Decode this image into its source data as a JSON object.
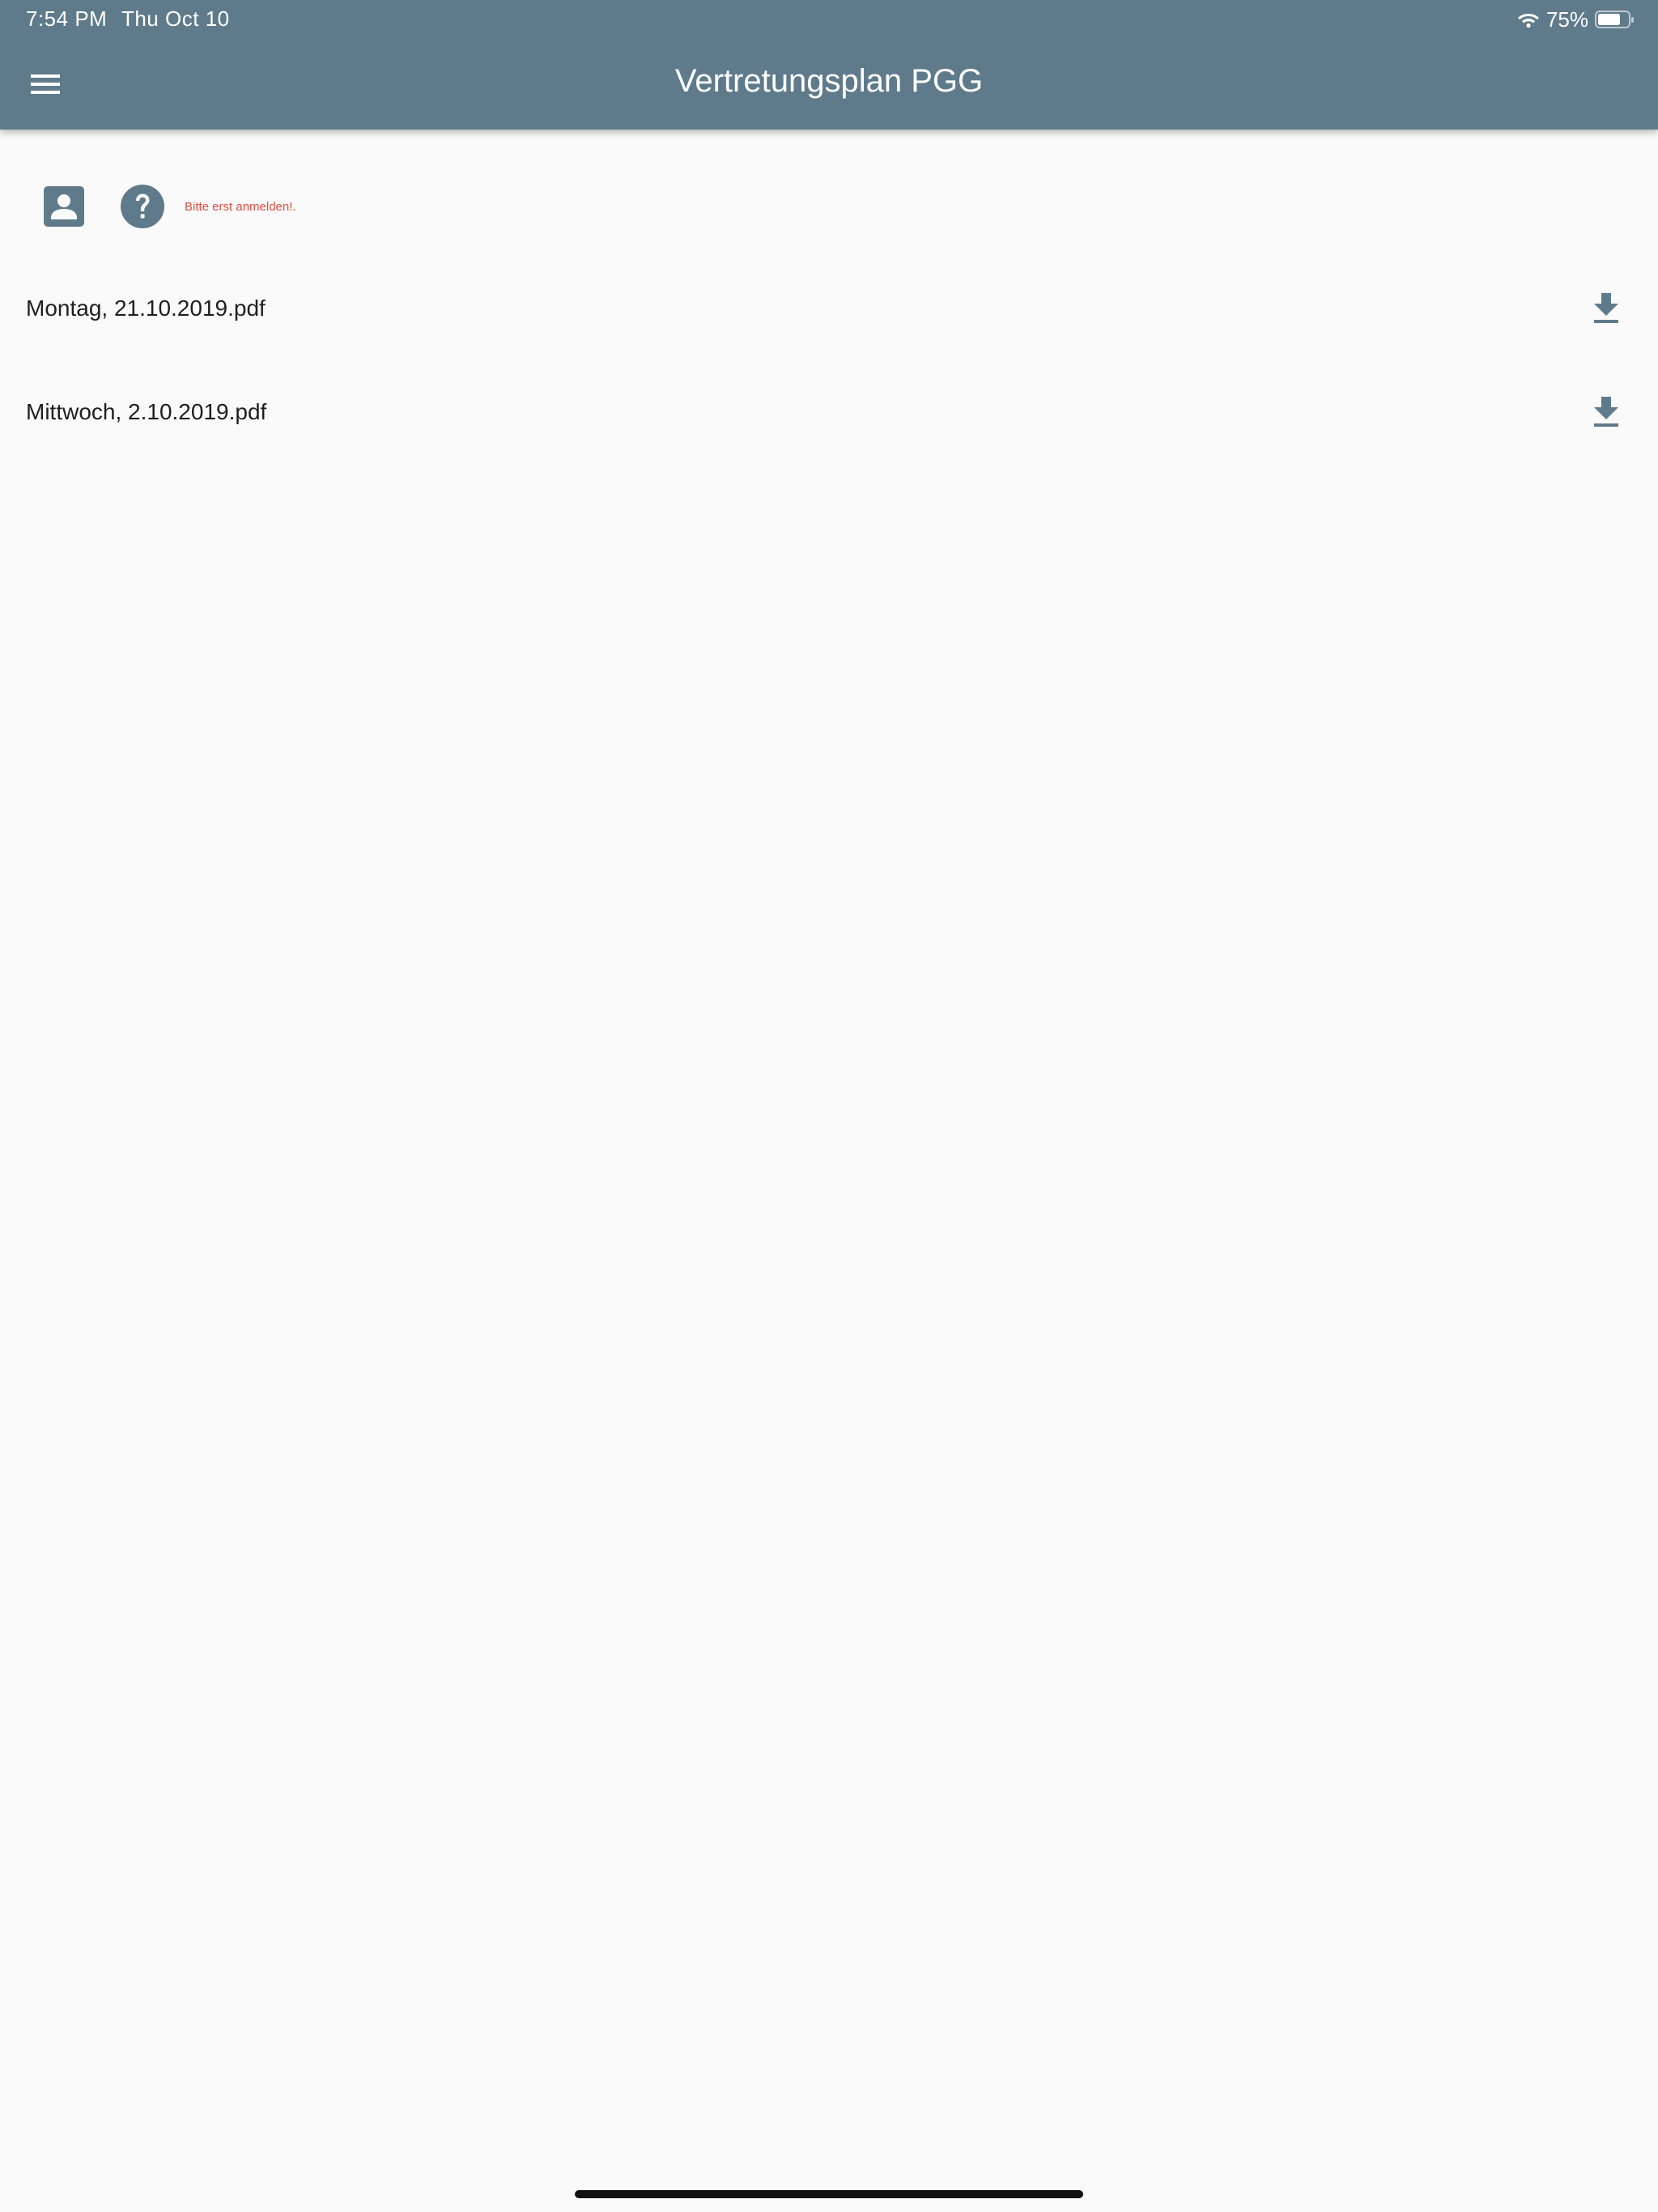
{
  "status_bar": {
    "time": "7:54 PM",
    "date": "Thu Oct 10",
    "battery": "75%",
    "battery_level": 0.75,
    "wifi_icon": "wifi-icon",
    "battery_icon": "battery-icon"
  },
  "app_bar": {
    "title": "Vertretungsplan PGG",
    "menu_icon": "hamburger-menu-icon",
    "color": "#5f7b8b"
  },
  "actions": {
    "profile_icon": "account-box-icon",
    "help_icon": "help-circle-icon",
    "login_hint": "Bitte erst anmelden!.",
    "hint_color": "#e04b3f"
  },
  "files": [
    {
      "name": "Montag, 21.10.2019.pdf",
      "icon": "download-icon"
    },
    {
      "name": "Mittwoch, 2.10.2019.pdf",
      "icon": "download-icon"
    }
  ],
  "colors": {
    "background": "#fafafa",
    "icon": "#5f7b8b",
    "text": "#1f1f1f"
  }
}
